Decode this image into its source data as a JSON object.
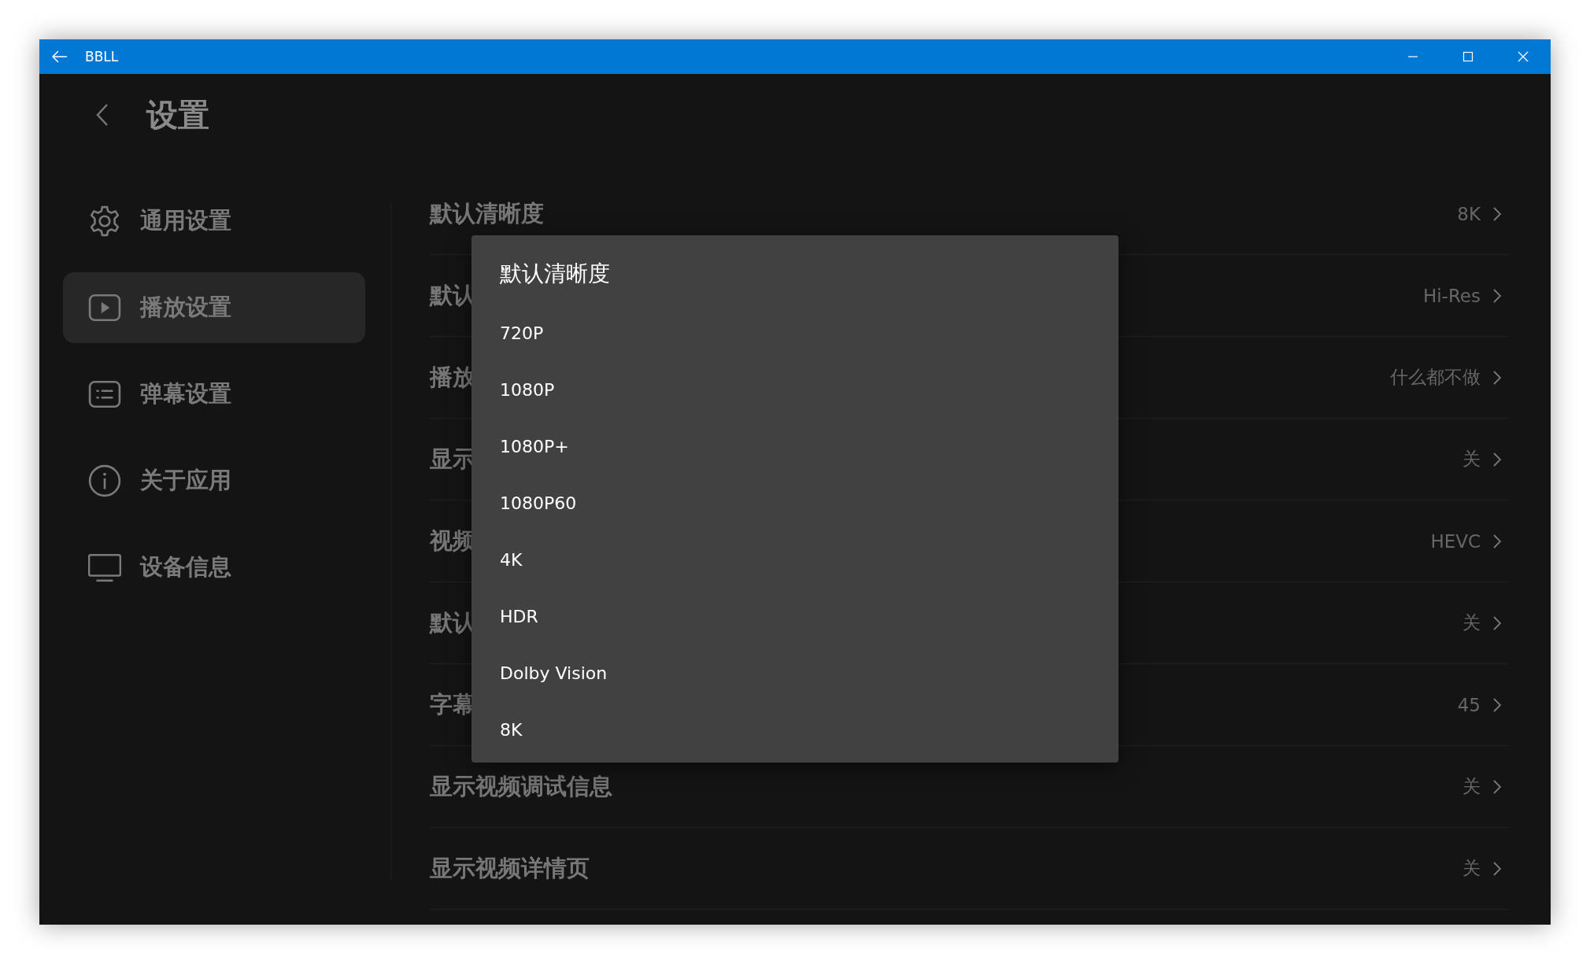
{
  "window": {
    "title": "BBLL"
  },
  "header": {
    "title": "设置"
  },
  "sidebar": {
    "items": [
      {
        "label": "通用设置",
        "selected": false
      },
      {
        "label": "播放设置",
        "selected": true
      },
      {
        "label": "弹幕设置",
        "selected": false
      },
      {
        "label": "关于应用",
        "selected": false
      },
      {
        "label": "设备信息",
        "selected": false
      }
    ]
  },
  "settings": [
    {
      "label": "默认清晰度",
      "value": "8K"
    },
    {
      "label": "默认",
      "value": "Hi-Res"
    },
    {
      "label": "播放",
      "value": "什么都不做"
    },
    {
      "label": "显示",
      "value": "关"
    },
    {
      "label": "视频",
      "value": "HEVC"
    },
    {
      "label": "默认",
      "value": "关"
    },
    {
      "label": "字幕",
      "value": "45"
    },
    {
      "label": "显示视频调试信息",
      "value": "关"
    },
    {
      "label": "显示视频详情页",
      "value": "关"
    }
  ],
  "dialog": {
    "title": "默认清晰度",
    "options": [
      "720P",
      "1080P",
      "1080P+",
      "1080P60",
      "4K",
      "HDR",
      "Dolby Vision",
      "8K"
    ]
  }
}
